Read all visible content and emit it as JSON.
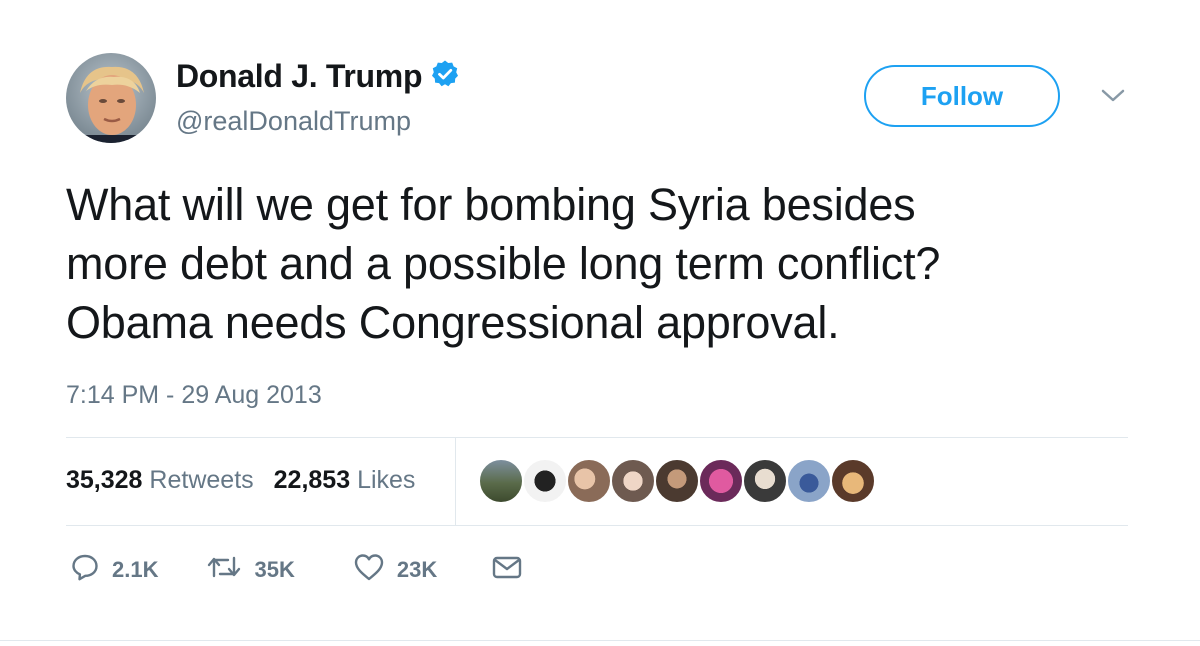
{
  "author": {
    "display_name": "Donald J. Trump",
    "handle": "@realDonaldTrump",
    "verified_icon": "verified-badge-icon"
  },
  "follow_button": {
    "label": "Follow"
  },
  "tweet": {
    "lines": [
      "What will we get for bombing Syria besides",
      "more debt and a possible long term conflict?",
      "Obama needs Congressional approval."
    ],
    "timestamp": "7:14 PM - 29 Aug 2013"
  },
  "stats": {
    "retweets_count": "35,328",
    "retweets_label": "Retweets",
    "likes_count": "22,853",
    "likes_label": "Likes"
  },
  "actions": {
    "reply_count": "2.1K",
    "retweet_count": "35K",
    "like_count": "23K"
  },
  "colors": {
    "accent": "#1da1f2",
    "text": "#14171a",
    "secondary_text": "#657786",
    "divider": "#e1e8ed"
  }
}
